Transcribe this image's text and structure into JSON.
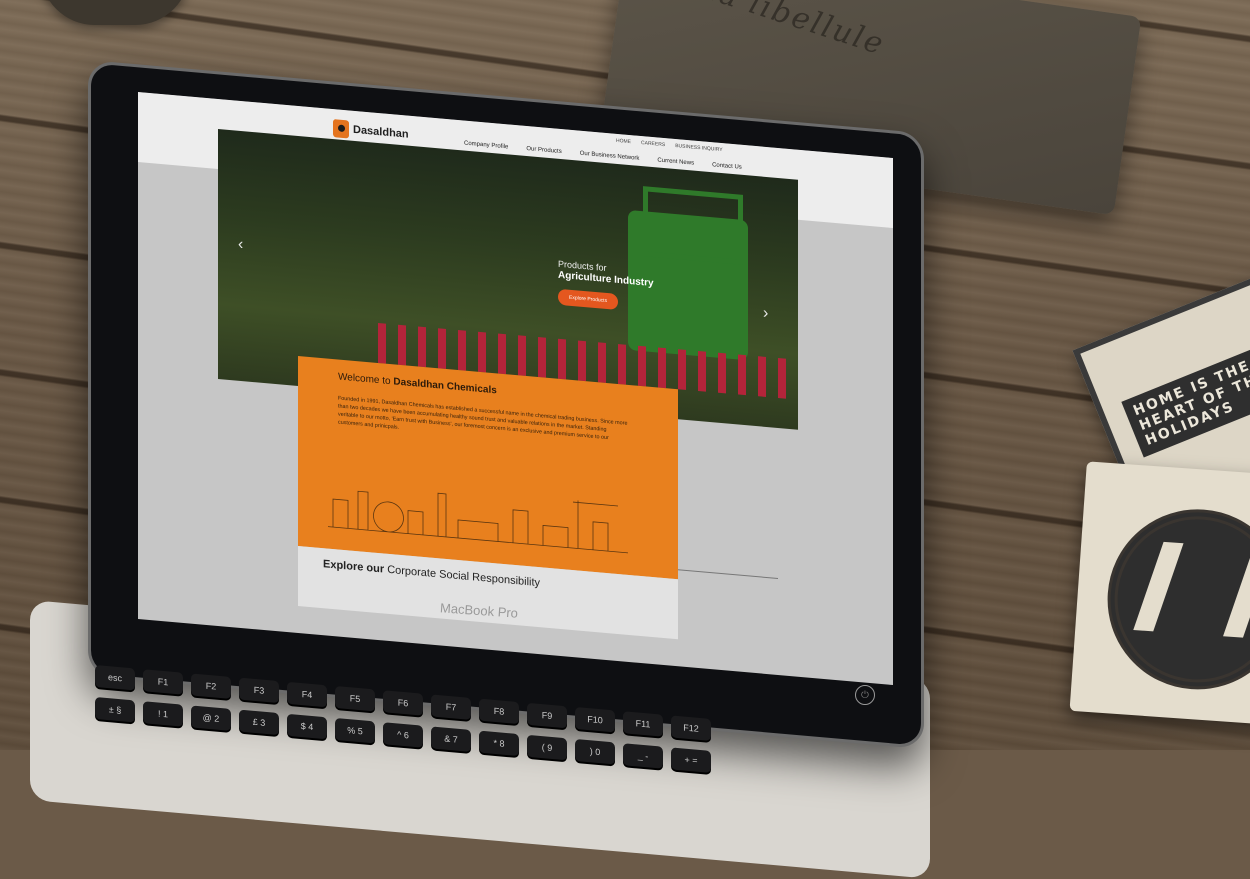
{
  "scene": {
    "pouch_text": "la libellule",
    "coaster_text": "HOME IS THE HEART OF THE HOLIDAYS",
    "laptop_label": "MacBook Pro"
  },
  "site": {
    "brand": "Dasaldhan",
    "utility_nav": [
      "HOME",
      "CAREERS",
      "BUSINESS INQUIRY"
    ],
    "main_nav": [
      "Company Profile",
      "Our Products",
      "Our Business Network",
      "Current News",
      "Contact Us"
    ],
    "hero": {
      "subtitle": "Products for",
      "title": "Agriculture Industry",
      "cta": "Explore Products"
    },
    "welcome": {
      "lead": "Welcome to",
      "company": "Dasaldhan Chemicals",
      "body": "Founded in 1991, Dasaldhan Chemicals has established a successful name in the chemical trading business. Since more than two decades we have been accumulating healthy sound trust and valuable relations in the market. Standing veritable to our motto, 'Earn trust with Business', our foremost concern is an exclusive and premium service to our customers and prinicpals."
    },
    "csr": {
      "bold": "Explore our",
      "rest": "Corporate Social Responsibility"
    }
  },
  "keyboard": {
    "row1": [
      "esc",
      "F1",
      "F2",
      "F3",
      "F4",
      "F5",
      "F6",
      "F7",
      "F8",
      "F9",
      "F10",
      "F11",
      "F12"
    ],
    "row2": [
      "±\n§",
      "!\n1",
      "@\n2",
      "£\n3",
      "$\n4",
      "%\n5",
      "^\n6",
      "&\n7",
      "*\n8",
      "(\n9",
      ")\n0",
      "_\n-",
      "+\n="
    ]
  }
}
